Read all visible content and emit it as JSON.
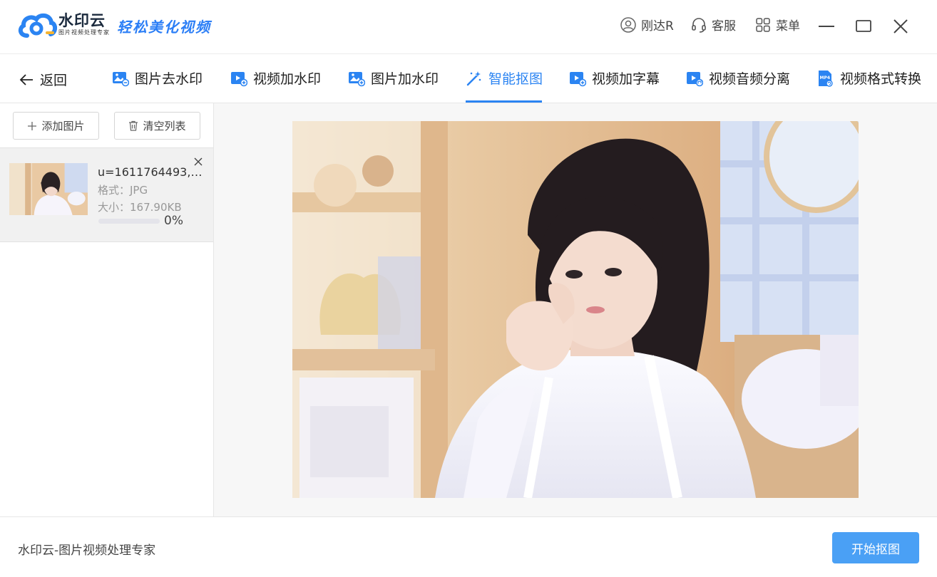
{
  "app": {
    "brand_name": "水印云",
    "brand_sub": "图片视频处理专家",
    "slogan": "轻松美化视频",
    "accent": "#2b84f2"
  },
  "titlebar": {
    "user_label": "刚达R",
    "service_label": "客服",
    "menu_label": "菜单",
    "icons": [
      "user-icon",
      "headset-icon",
      "grid-icon",
      "minimize-icon",
      "maximize-icon",
      "close-icon"
    ]
  },
  "nav": {
    "back_label": "返回",
    "tabs": [
      {
        "label": "图片去水印",
        "icon": "image-remove-icon"
      },
      {
        "label": "视频加水印",
        "icon": "video-add-icon"
      },
      {
        "label": "图片加水印",
        "icon": "image-add-icon"
      },
      {
        "label": "智能抠图",
        "icon": "magic-wand-icon",
        "active": true
      },
      {
        "label": "视频加字幕",
        "icon": "video-subtitle-icon"
      },
      {
        "label": "视频音频分离",
        "icon": "video-audio-icon"
      },
      {
        "label": "视频格式转换",
        "icon": "mp4-convert-icon"
      }
    ]
  },
  "sidebar": {
    "add_label": "添加图片",
    "clear_label": "清空列表",
    "files": [
      {
        "name": "u=1611764493,3...",
        "format": "格式：JPG",
        "size": "大小：167.90KB",
        "progress_text": "0%",
        "progress": 0
      }
    ]
  },
  "footer": {
    "text": "水印云-图片视频处理专家",
    "start_label": "开始抠图"
  }
}
